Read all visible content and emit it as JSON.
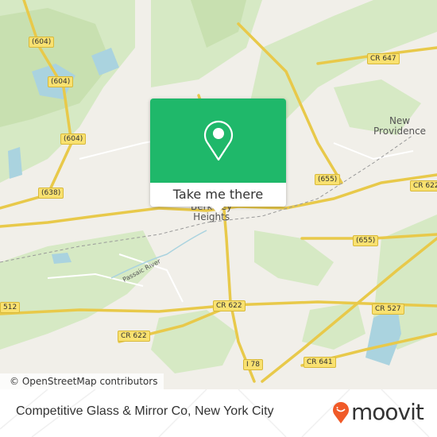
{
  "map": {
    "attribution": "© OpenStreetMap contributors",
    "places": [
      {
        "name": "New\nProvidence"
      },
      {
        "name": "Berkeley\nHeights"
      }
    ],
    "river": "Passaic River",
    "road_labels": [
      "(604)",
      "(604)",
      "(604)",
      "(638)",
      "CR 647",
      "(655)",
      "CR 622",
      "(655)",
      "CR 622",
      "CR 527",
      "CR 622",
      "512",
      "I 78",
      "CR 641"
    ],
    "colors": {
      "land": "#f1efe9",
      "wood": "#d6e9c4",
      "water": "#aad3df",
      "road": "#f9e170"
    }
  },
  "popup": {
    "icon": "map-pin-icon",
    "button_label": "Take me there",
    "color": "#1fb86a"
  },
  "footer": {
    "title": "Competitive Glass & Mirror Co, New York City",
    "brand": "moovit",
    "brand_color": "#f05a28"
  }
}
